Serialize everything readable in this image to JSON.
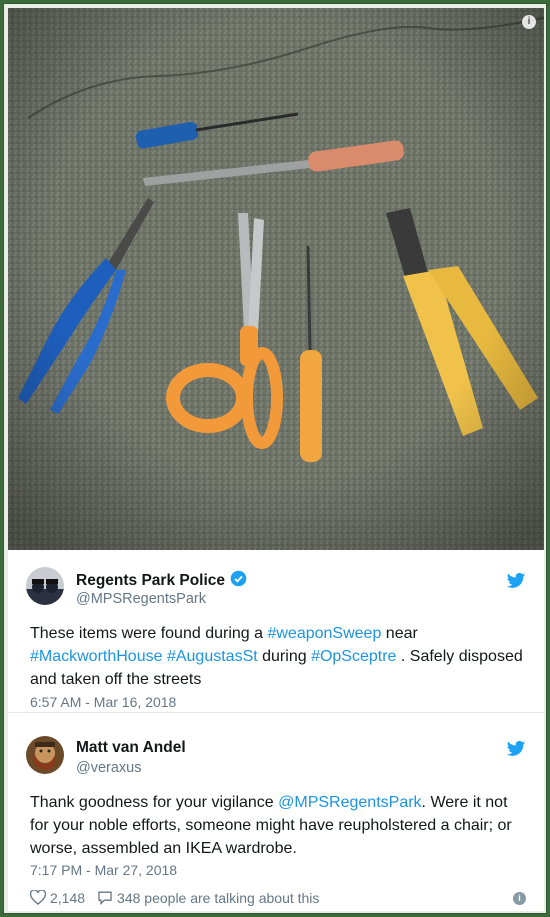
{
  "photo": {
    "info_glyph": "i",
    "description_icon": "tools-on-pavement-photo"
  },
  "tweet1": {
    "author_name": "Regents Park Police",
    "handle": "@MPSRegentsPark",
    "text_parts": [
      "These items were found during a ",
      "#weaponSweep",
      " near ",
      "#MackworthHouse",
      " ",
      "#AugustasSt",
      " during ",
      "#OpSceptre",
      " . Safely disposed and taken off the streets"
    ],
    "timestamp": "6:57 AM - Mar 16, 2018"
  },
  "tweet2": {
    "author_name": "Matt van Andel",
    "handle": "@veraxus",
    "text_parts": [
      "Thank goodness for your vigilance ",
      "@MPSRegentsPark",
      ". Were it not for your noble efforts, someone might have reupholstered a chair; or worse, assembled an IKEA wardrobe."
    ],
    "timestamp": "7:17 PM - Mar 27, 2018",
    "likes": "2,148",
    "talking": "348 people are talking about this",
    "info_glyph": "i"
  },
  "colors": {
    "link": "#1b95e0",
    "twitter_blue": "#1da1f2",
    "frame_green": "#3c6a3a"
  }
}
